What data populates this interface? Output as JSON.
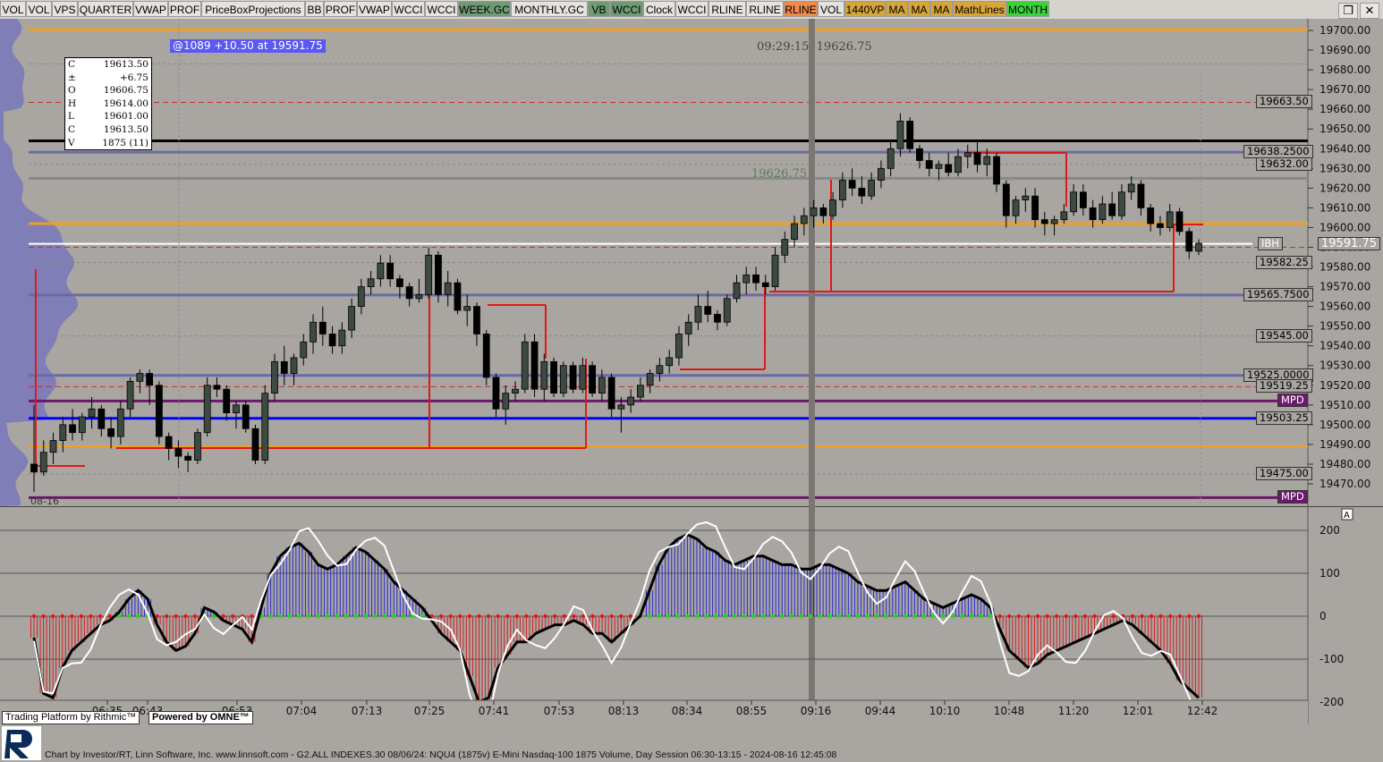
{
  "toolbar": [
    {
      "label": "VOL",
      "bg": "#e6e3de"
    },
    {
      "label": "VOL",
      "bg": "#e6e3de"
    },
    {
      "label": "VPS",
      "bg": "#e6e3de"
    },
    {
      "label": "QUARTER",
      "bg": "#e6e3de"
    },
    {
      "label": "VWAP",
      "bg": "#e6e3de"
    },
    {
      "label": "PROF",
      "bg": "#e6e3de"
    },
    {
      "label": "PriceBoxProjections",
      "bg": "#e6e3de"
    },
    {
      "label": "BB",
      "bg": "#e6e3de"
    },
    {
      "label": "PROF",
      "bg": "#e6e3de"
    },
    {
      "label": "VWAP",
      "bg": "#e6e3de"
    },
    {
      "label": "WCCI",
      "bg": "#e6e3de"
    },
    {
      "label": "WCCI",
      "bg": "#e6e3de"
    },
    {
      "label": "WEEK.GC",
      "bg": "#6f9a73"
    },
    {
      "label": "MONTHLY.GC",
      "bg": "#e6e3de"
    },
    {
      "label": "VB",
      "bg": "#6f9a73"
    },
    {
      "label": "WCCI",
      "bg": "#6f9a73"
    },
    {
      "label": "Clock",
      "bg": "#e6e3de"
    },
    {
      "label": "WCCI",
      "bg": "#e6e3de"
    },
    {
      "label": "RLINE",
      "bg": "#e6e3de"
    },
    {
      "label": "RLINE",
      "bg": "#e6e3de"
    },
    {
      "label": "RLINE",
      "bg": "#f08a4a"
    },
    {
      "label": "VOL",
      "bg": "#e6e3de"
    },
    {
      "label": "1440VP",
      "bg": "#d6a63a"
    },
    {
      "label": "MA",
      "bg": "#d6a63a"
    },
    {
      "label": "MA",
      "bg": "#d6a63a"
    },
    {
      "label": "MA",
      "bg": "#d6a63a"
    },
    {
      "label": "MathLines",
      "bg": "#d6a63a"
    },
    {
      "label": "MONTH",
      "bg": "#3ad23a"
    }
  ],
  "window_controls": {
    "restore": "❐",
    "close": "✕"
  },
  "ohlc": [
    {
      "k": "C",
      "v": "19613.50"
    },
    {
      "k": "±",
      "v": "+6.75"
    },
    {
      "k": "O",
      "v": "19606.75"
    },
    {
      "k": "H",
      "v": "19614.00"
    },
    {
      "k": "L",
      "v": "19601.00"
    },
    {
      "k": "C",
      "v": "19613.50"
    },
    {
      "k": "V",
      "v": "1875 (11)"
    }
  ],
  "last_trade": "@1089  +10.50 at 19591.75",
  "clock": "09:29:15",
  "clock_price": "19626.75",
  "ref_price": "19626.75",
  "price_axis": {
    "min": 19462,
    "max": 19705,
    "ticks": [
      "19700.00",
      "19690.00",
      "19680.00",
      "19670.00",
      "19660.00",
      "19650.00",
      "19640.00",
      "19630.00",
      "19620.00",
      "19610.00",
      "19600.00",
      "19590.00",
      "19580.00",
      "19570.00",
      "19560.00",
      "19550.00",
      "19540.00",
      "19530.00",
      "19520.00",
      "19510.00",
      "19500.00",
      "19490.00",
      "19480.00",
      "19470.00"
    ]
  },
  "level_labels": [
    {
      "text": "19663.50",
      "price": 19663.5,
      "bg": "#a9a6a1",
      "fg": "#000"
    },
    {
      "text": "19638.2500",
      "price": 19638.25,
      "bg": "#a9a6a1",
      "fg": "#000"
    },
    {
      "text": "19632.00",
      "price": 19632.0,
      "bg": "#a9a6a1",
      "fg": "#000"
    },
    {
      "text": "IBH",
      "price": 19591.75,
      "bg": "#a9a6a1",
      "fg": "#fff"
    },
    {
      "text": "19591.75",
      "price": 19591.75,
      "bg": "#a9a6a1",
      "fg": "#fff"
    },
    {
      "text": "19582.25",
      "price": 19582.25,
      "bg": "#a9a6a1",
      "fg": "#000"
    },
    {
      "text": "19565.7500",
      "price": 19565.75,
      "bg": "#a9a6a1",
      "fg": "#000"
    },
    {
      "text": "19545.00",
      "price": 19545.0,
      "bg": "#a9a6a1",
      "fg": "#000"
    },
    {
      "text": "19525.0000",
      "price": 19525.0,
      "bg": "#a9a6a1",
      "fg": "#000"
    },
    {
      "text": "19519.25",
      "price": 19519.25,
      "bg": "#a9a6a1",
      "fg": "#000"
    },
    {
      "text": "MPD",
      "price": 19512.0,
      "bg": "#6a1a6a",
      "fg": "#fff"
    },
    {
      "text": "19503.25",
      "price": 19503.25,
      "bg": "#a9a6a1",
      "fg": "#000"
    },
    {
      "text": "19475.00",
      "price": 19475.0,
      "bg": "#a9a6a1",
      "fg": "#000"
    },
    {
      "text": "MPD",
      "price": 19463.0,
      "bg": "#6a1a6a",
      "fg": "#fff"
    }
  ],
  "time_axis": [
    "06:35",
    "06:43",
    "06:53",
    "07:04",
    "07:13",
    "07:25",
    "07:41",
    "07:53",
    "08:13",
    "08:34",
    "08:55",
    "09:16",
    "09:44",
    "10:10",
    "10:48",
    "11:20",
    "12:01",
    "12:42"
  ],
  "date_label": "08-16",
  "osc_axis": [
    "200",
    "100",
    "0",
    "-100",
    "-200"
  ],
  "osc_marker": "A",
  "branding": {
    "platform": "Trading Platform by Rithmic™",
    "omne": "Powered by OMNE™"
  },
  "status_line": "Chart by Investor/RT, Linn Software, Inc. www.linnsoft.com - G2.ALL INDEXES.30     08/06/24: NQU4 (1875v) E-Mini Nasdaq-100 1875 Volume, Day Session 06:30-13:15 - 2024-08-16 12:45:08",
  "colors": {
    "bull": "#3d4a41",
    "bear": "#000000",
    "bg": "#a9a6a1",
    "blue_line": "#0000ff",
    "red_line": "#ff0000",
    "orange_line": "#f0a020",
    "purple_line": "#6a6aa8"
  },
  "chart_data": {
    "type": "candlestick",
    "instrument": "NQU4",
    "bars": [
      [
        19480,
        19510,
        19466,
        19476
      ],
      [
        19476,
        19492,
        19474,
        19486
      ],
      [
        19486,
        19496,
        19480,
        19492
      ],
      [
        19492,
        19504,
        19486,
        19500
      ],
      [
        19500,
        19508,
        19492,
        19496
      ],
      [
        19496,
        19506,
        19492,
        19504
      ],
      [
        19504,
        19514,
        19498,
        19508
      ],
      [
        19508,
        19510,
        19494,
        19498
      ],
      [
        19498,
        19504,
        19488,
        19494
      ],
      [
        19494,
        19512,
        19490,
        19508
      ],
      [
        19508,
        19524,
        19504,
        19522
      ],
      [
        19522,
        19528,
        19516,
        19526
      ],
      [
        19526,
        19528,
        19510,
        19520
      ],
      [
        19520,
        19522,
        19490,
        19494
      ],
      [
        19494,
        19496,
        19482,
        19488
      ],
      [
        19488,
        19492,
        19478,
        19484
      ],
      [
        19484,
        19486,
        19476,
        19482
      ],
      [
        19482,
        19498,
        19480,
        19496
      ],
      [
        19496,
        19524,
        19494,
        19520
      ],
      [
        19520,
        19524,
        19514,
        19518
      ],
      [
        19518,
        19520,
        19502,
        19506
      ],
      [
        19506,
        19512,
        19498,
        19510
      ],
      [
        19510,
        19512,
        19496,
        19498
      ],
      [
        19498,
        19500,
        19480,
        19482
      ],
      [
        19482,
        19520,
        19480,
        19516
      ],
      [
        19516,
        19536,
        19512,
        19532
      ],
      [
        19532,
        19540,
        19520,
        19526
      ],
      [
        19526,
        19536,
        19520,
        19534
      ],
      [
        19534,
        19546,
        19530,
        19542
      ],
      [
        19542,
        19556,
        19536,
        19552
      ],
      [
        19552,
        19560,
        19540,
        19546
      ],
      [
        19546,
        19550,
        19536,
        19540
      ],
      [
        19540,
        19552,
        19536,
        19548
      ],
      [
        19548,
        19564,
        19544,
        19560
      ],
      [
        19560,
        19574,
        19556,
        19570
      ],
      [
        19570,
        19578,
        19566,
        19574
      ],
      [
        19574,
        19586,
        19570,
        19582
      ],
      [
        19582,
        19586,
        19570,
        19574
      ],
      [
        19574,
        19576,
        19564,
        19570
      ],
      [
        19570,
        19572,
        19560,
        19564
      ],
      [
        19564,
        19574,
        19562,
        19566
      ],
      [
        19566,
        19590,
        19564,
        19586
      ],
      [
        19586,
        19588,
        19562,
        19566
      ],
      [
        19566,
        19578,
        19560,
        19572
      ],
      [
        19572,
        19574,
        19556,
        19558
      ],
      [
        19558,
        19566,
        19550,
        19560
      ],
      [
        19560,
        19562,
        19540,
        19546
      ],
      [
        19546,
        19548,
        19520,
        19524
      ],
      [
        19524,
        19526,
        19504,
        19508
      ],
      [
        19508,
        19520,
        19500,
        19516
      ],
      [
        19516,
        19522,
        19512,
        19518
      ],
      [
        19518,
        19546,
        19516,
        19542
      ],
      [
        19542,
        19546,
        19514,
        19518
      ],
      [
        19518,
        19536,
        19512,
        19532
      ],
      [
        19532,
        19534,
        19514,
        19516
      ],
      [
        19516,
        19532,
        19514,
        19530
      ],
      [
        19530,
        19532,
        19516,
        19518
      ],
      [
        19518,
        19534,
        19516,
        19530
      ],
      [
        19530,
        19532,
        19514,
        19516
      ],
      [
        19516,
        19528,
        19512,
        19524
      ],
      [
        19524,
        19526,
        19504,
        19508
      ],
      [
        19508,
        19514,
        19496,
        19510
      ],
      [
        19510,
        19518,
        19506,
        19514
      ],
      [
        19514,
        19524,
        19512,
        19520
      ],
      [
        19520,
        19528,
        19516,
        19526
      ],
      [
        19526,
        19534,
        19522,
        19530
      ],
      [
        19530,
        19538,
        19526,
        19534
      ],
      [
        19534,
        19550,
        19530,
        19546
      ],
      [
        19546,
        19556,
        19540,
        19552
      ],
      [
        19552,
        19566,
        19548,
        19560
      ],
      [
        19560,
        19568,
        19552,
        19556
      ],
      [
        19556,
        19558,
        19548,
        19552
      ],
      [
        19552,
        19566,
        19550,
        19564
      ],
      [
        19564,
        19576,
        19562,
        19572
      ],
      [
        19572,
        19580,
        19566,
        19576
      ],
      [
        19576,
        19580,
        19568,
        19572
      ],
      [
        19572,
        19576,
        19566,
        19570
      ],
      [
        19570,
        19590,
        19568,
        19586
      ],
      [
        19586,
        19598,
        19582,
        19594
      ],
      [
        19594,
        19606,
        19590,
        19602
      ],
      [
        19602,
        19610,
        19596,
        19606
      ],
      [
        19606,
        19614,
        19600,
        19610
      ],
      [
        19610,
        19612,
        19602,
        19606
      ],
      [
        19606,
        19618,
        19604,
        19614
      ],
      [
        19614,
        19628,
        19610,
        19624
      ],
      [
        19624,
        19630,
        19616,
        19620
      ],
      [
        19620,
        19626,
        19612,
        19616
      ],
      [
        19616,
        19628,
        19614,
        19624
      ],
      [
        19624,
        19634,
        19620,
        19630
      ],
      [
        19630,
        19644,
        19626,
        19640
      ],
      [
        19640,
        19658,
        19636,
        19654
      ],
      [
        19654,
        19656,
        19638,
        19640
      ],
      [
        19640,
        19642,
        19630,
        19634
      ],
      [
        19634,
        19638,
        19626,
        19630
      ],
      [
        19630,
        19634,
        19624,
        19632
      ],
      [
        19632,
        19638,
        19626,
        19628
      ],
      [
        19628,
        19640,
        19626,
        19636
      ],
      [
        19636,
        19642,
        19630,
        19638
      ],
      [
        19638,
        19644,
        19628,
        19632
      ],
      [
        19632,
        19640,
        19626,
        19636
      ],
      [
        19636,
        19638,
        19618,
        19622
      ],
      [
        19622,
        19624,
        19600,
        19606
      ],
      [
        19606,
        19616,
        19602,
        19614
      ],
      [
        19614,
        19620,
        19608,
        19616
      ],
      [
        19616,
        19620,
        19600,
        19604
      ],
      [
        19604,
        19608,
        19596,
        19602
      ],
      [
        19602,
        19606,
        19596,
        19604
      ],
      [
        19604,
        19612,
        19602,
        19608
      ],
      [
        19608,
        19622,
        19606,
        19618
      ],
      [
        19618,
        19622,
        19606,
        19610
      ],
      [
        19610,
        19614,
        19600,
        19604
      ],
      [
        19604,
        19616,
        19602,
        19612
      ],
      [
        19612,
        19618,
        19604,
        19606
      ],
      [
        19606,
        19622,
        19604,
        19618
      ],
      [
        19618,
        19626,
        19614,
        19622
      ],
      [
        19622,
        19624,
        19606,
        19610
      ],
      [
        19610,
        19612,
        19598,
        19602
      ],
      [
        19602,
        19606,
        19596,
        19600
      ],
      [
        19600,
        19612,
        19598,
        19608
      ],
      [
        19608,
        19610,
        19596,
        19598
      ],
      [
        19598,
        19600,
        19584,
        19588
      ],
      [
        19588,
        19594,
        19586,
        19592
      ]
    ],
    "wcci": [
      -50,
      -180,
      -190,
      -120,
      -80,
      -60,
      -40,
      -20,
      -10,
      10,
      40,
      60,
      40,
      -20,
      -60,
      -80,
      -70,
      -40,
      20,
      10,
      -10,
      -20,
      -30,
      -60,
      20,
      100,
      140,
      160,
      170,
      150,
      120,
      110,
      120,
      140,
      160,
      150,
      130,
      110,
      80,
      60,
      40,
      20,
      -10,
      -40,
      -60,
      -80,
      -140,
      -200,
      -190,
      -120,
      -90,
      -60,
      -60,
      -40,
      -30,
      -20,
      -20,
      -10,
      -20,
      -40,
      -40,
      -60,
      -40,
      -20,
      0,
      60,
      120,
      160,
      180,
      190,
      180,
      160,
      150,
      130,
      120,
      130,
      140,
      140,
      130,
      120,
      120,
      110,
      110,
      120,
      120,
      110,
      100,
      80,
      70,
      60,
      60,
      70,
      80,
      60,
      40,
      30,
      20,
      30,
      40,
      50,
      40,
      20,
      -30,
      -80,
      -100,
      -120,
      -110,
      -90,
      -80,
      -70,
      -60,
      -50,
      -40,
      -30,
      -20,
      -10,
      -20,
      -40,
      -60,
      -80,
      -110,
      -150,
      -170,
      -190
    ]
  }
}
